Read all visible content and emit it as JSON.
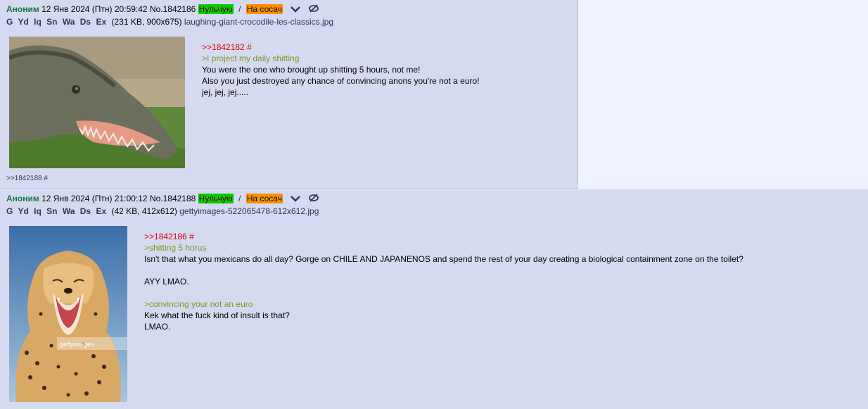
{
  "posts": [
    {
      "name": "Аноним",
      "date": "12 Янв 2024 (Птн) 20:59:42",
      "number": "No.1842186",
      "badge1": "Нульчую",
      "sep": "/",
      "badge2": "На сосач",
      "search_engines": [
        "G",
        "Yd",
        "Iq",
        "Sn",
        "Wa",
        "Ds",
        "Ex"
      ],
      "file_info": "(231 KB, 900x675)",
      "file_name": "laughing-giant-crocodile-les-classics.jpg",
      "message": {
        "quote_link": ">>1842182 #",
        "greentext": ">I project my daily shitting",
        "line1": "You were the one who brought up shitting 5 hours, not me!",
        "line2": "Also you just destroyed any chance of convincing anons you're not a euro!",
        "line3": "jej, jej, jej....."
      },
      "reply_ref": ">>1842188 #"
    },
    {
      "name": "Аноним",
      "date": "12 Янв 2024 (Птн) 21:00:12",
      "number": "No.1842188",
      "badge1": "Нульчую",
      "sep": "/",
      "badge2": "На сосач",
      "search_engines": [
        "G",
        "Yd",
        "Iq",
        "Sn",
        "Wa",
        "Ds",
        "Ex"
      ],
      "file_info": "(42 KB, 412x612)",
      "file_name": "gettyimages-522065478-612x612.jpg",
      "message": {
        "quote_link": ">>1842186 #",
        "greentext1": ">shitting 5 horus",
        "line1": "Isn't that what you mexicans do all day? Gorge on CHILE AND JAPANENOS and spend the rest of your day creating a biological containment zone on the toilet?",
        "line2": "AYY LMAO.",
        "greentext2": ">convincing your not an euro",
        "line3": "Kek what the fuck kind of insult is that?",
        "line4": "LMAO."
      },
      "watermark": "gettyimages"
    }
  ],
  "colors": {
    "post_bg": "#d6daf0",
    "page_bg": "#eef2ff",
    "name": "#117743",
    "quote_link": "#dd0000",
    "greentext": "#789922"
  }
}
